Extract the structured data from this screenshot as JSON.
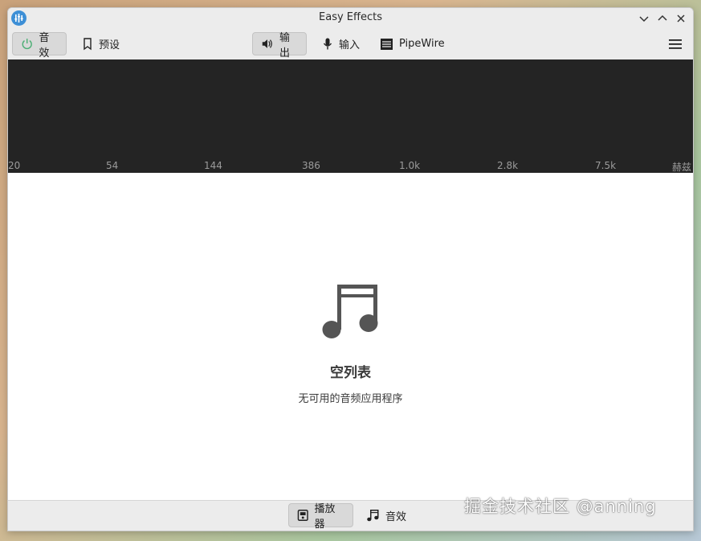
{
  "window": {
    "title": "Easy Effects"
  },
  "header": {
    "effects_label": "音效",
    "presets_label": "预设",
    "output_label": "输出",
    "input_label": "输入",
    "pipewire_label": "PipeWire"
  },
  "spectrum": {
    "ticks": [
      "20",
      "54",
      "144",
      "386",
      "1.0k",
      "2.8k",
      "7.5k",
      "赫兹"
    ]
  },
  "main": {
    "empty_title": "空列表",
    "empty_subtitle": "无可用的音频应用程序"
  },
  "bottom": {
    "players_label": "播放器",
    "effects_label": "音效"
  },
  "watermark": {
    "text": "掘金技术社区 @anning"
  },
  "colors": {
    "accent": "#3d8fd6",
    "power_green": "#4caf75",
    "spectrum_bg": "#242424"
  },
  "icons": [
    "app-logo-icon",
    "minimize-icon",
    "maximize-icon",
    "close-icon",
    "power-icon",
    "bookmark-icon",
    "speaker-icon",
    "microphone-icon",
    "server-icon",
    "hamburger-menu-icon",
    "music-note-icon",
    "player-icon",
    "music-note-small-icon"
  ]
}
